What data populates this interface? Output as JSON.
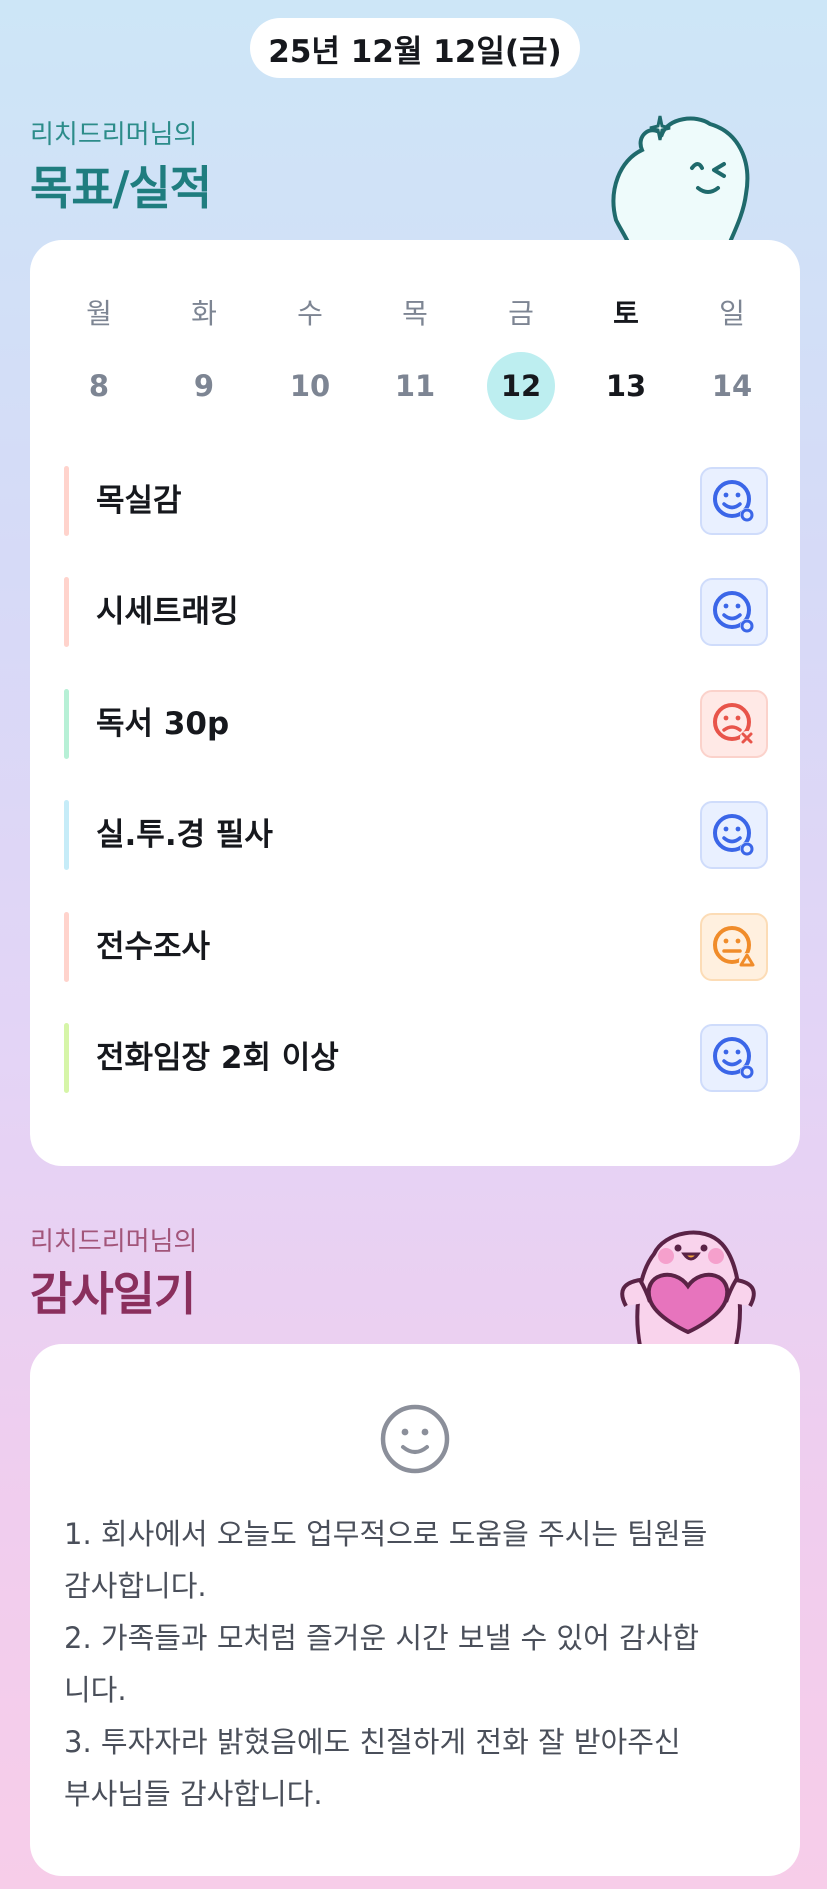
{
  "header": {
    "date": "25년 12월 12일(금)"
  },
  "goals_section": {
    "subtitle": "리치드리머님의",
    "title": "목표/실적"
  },
  "calendar": {
    "weekdays": [
      "월",
      "화",
      "수",
      "목",
      "금",
      "토",
      "일"
    ],
    "days": [
      "8",
      "9",
      "10",
      "11",
      "12",
      "13",
      "14"
    ],
    "selected_day": "12",
    "today_day": "13"
  },
  "goals": [
    {
      "label": "목실감",
      "bar_color": "#ffd3cc",
      "status": "done"
    },
    {
      "label": "시세트래킹",
      "bar_color": "#ffd3cc",
      "status": "done"
    },
    {
      "label": "독서 30p",
      "bar_color": "#b7f0d6",
      "status": "fail"
    },
    {
      "label": "실.투.경 필사",
      "bar_color": "#c6ecf8",
      "status": "done"
    },
    {
      "label": "전수조사",
      "bar_color": "#ffd3cc",
      "status": "partial"
    },
    {
      "label": "전화임장 2회 이상",
      "bar_color": "#d6f5a8",
      "status": "done"
    }
  ],
  "gratitude_section": {
    "subtitle": "리치드리머님의",
    "title": "감사일기",
    "mood_icon": "neutral-smiley-icon",
    "lines": [
      "1. 회사에서 오늘도 업무적으로 도움을 주시는 팀원들",
      "감사합니다.",
      "2. 가족들과 모처럼 즐거운 시간 보낼 수 있어 감사합",
      "니다.",
      "3. 투자자라 밝혔음에도 친절하게 전화 잘 받아주신",
      "부사님들 감사합니다."
    ]
  },
  "colors": {
    "status_done": "#3b66e8",
    "status_fail": "#e8544a",
    "status_partial": "#f08c2a",
    "goal_title": "#1f7d7f",
    "gratitude_title": "#8a2f5d",
    "selected_day_bg": "#bdeef0"
  }
}
